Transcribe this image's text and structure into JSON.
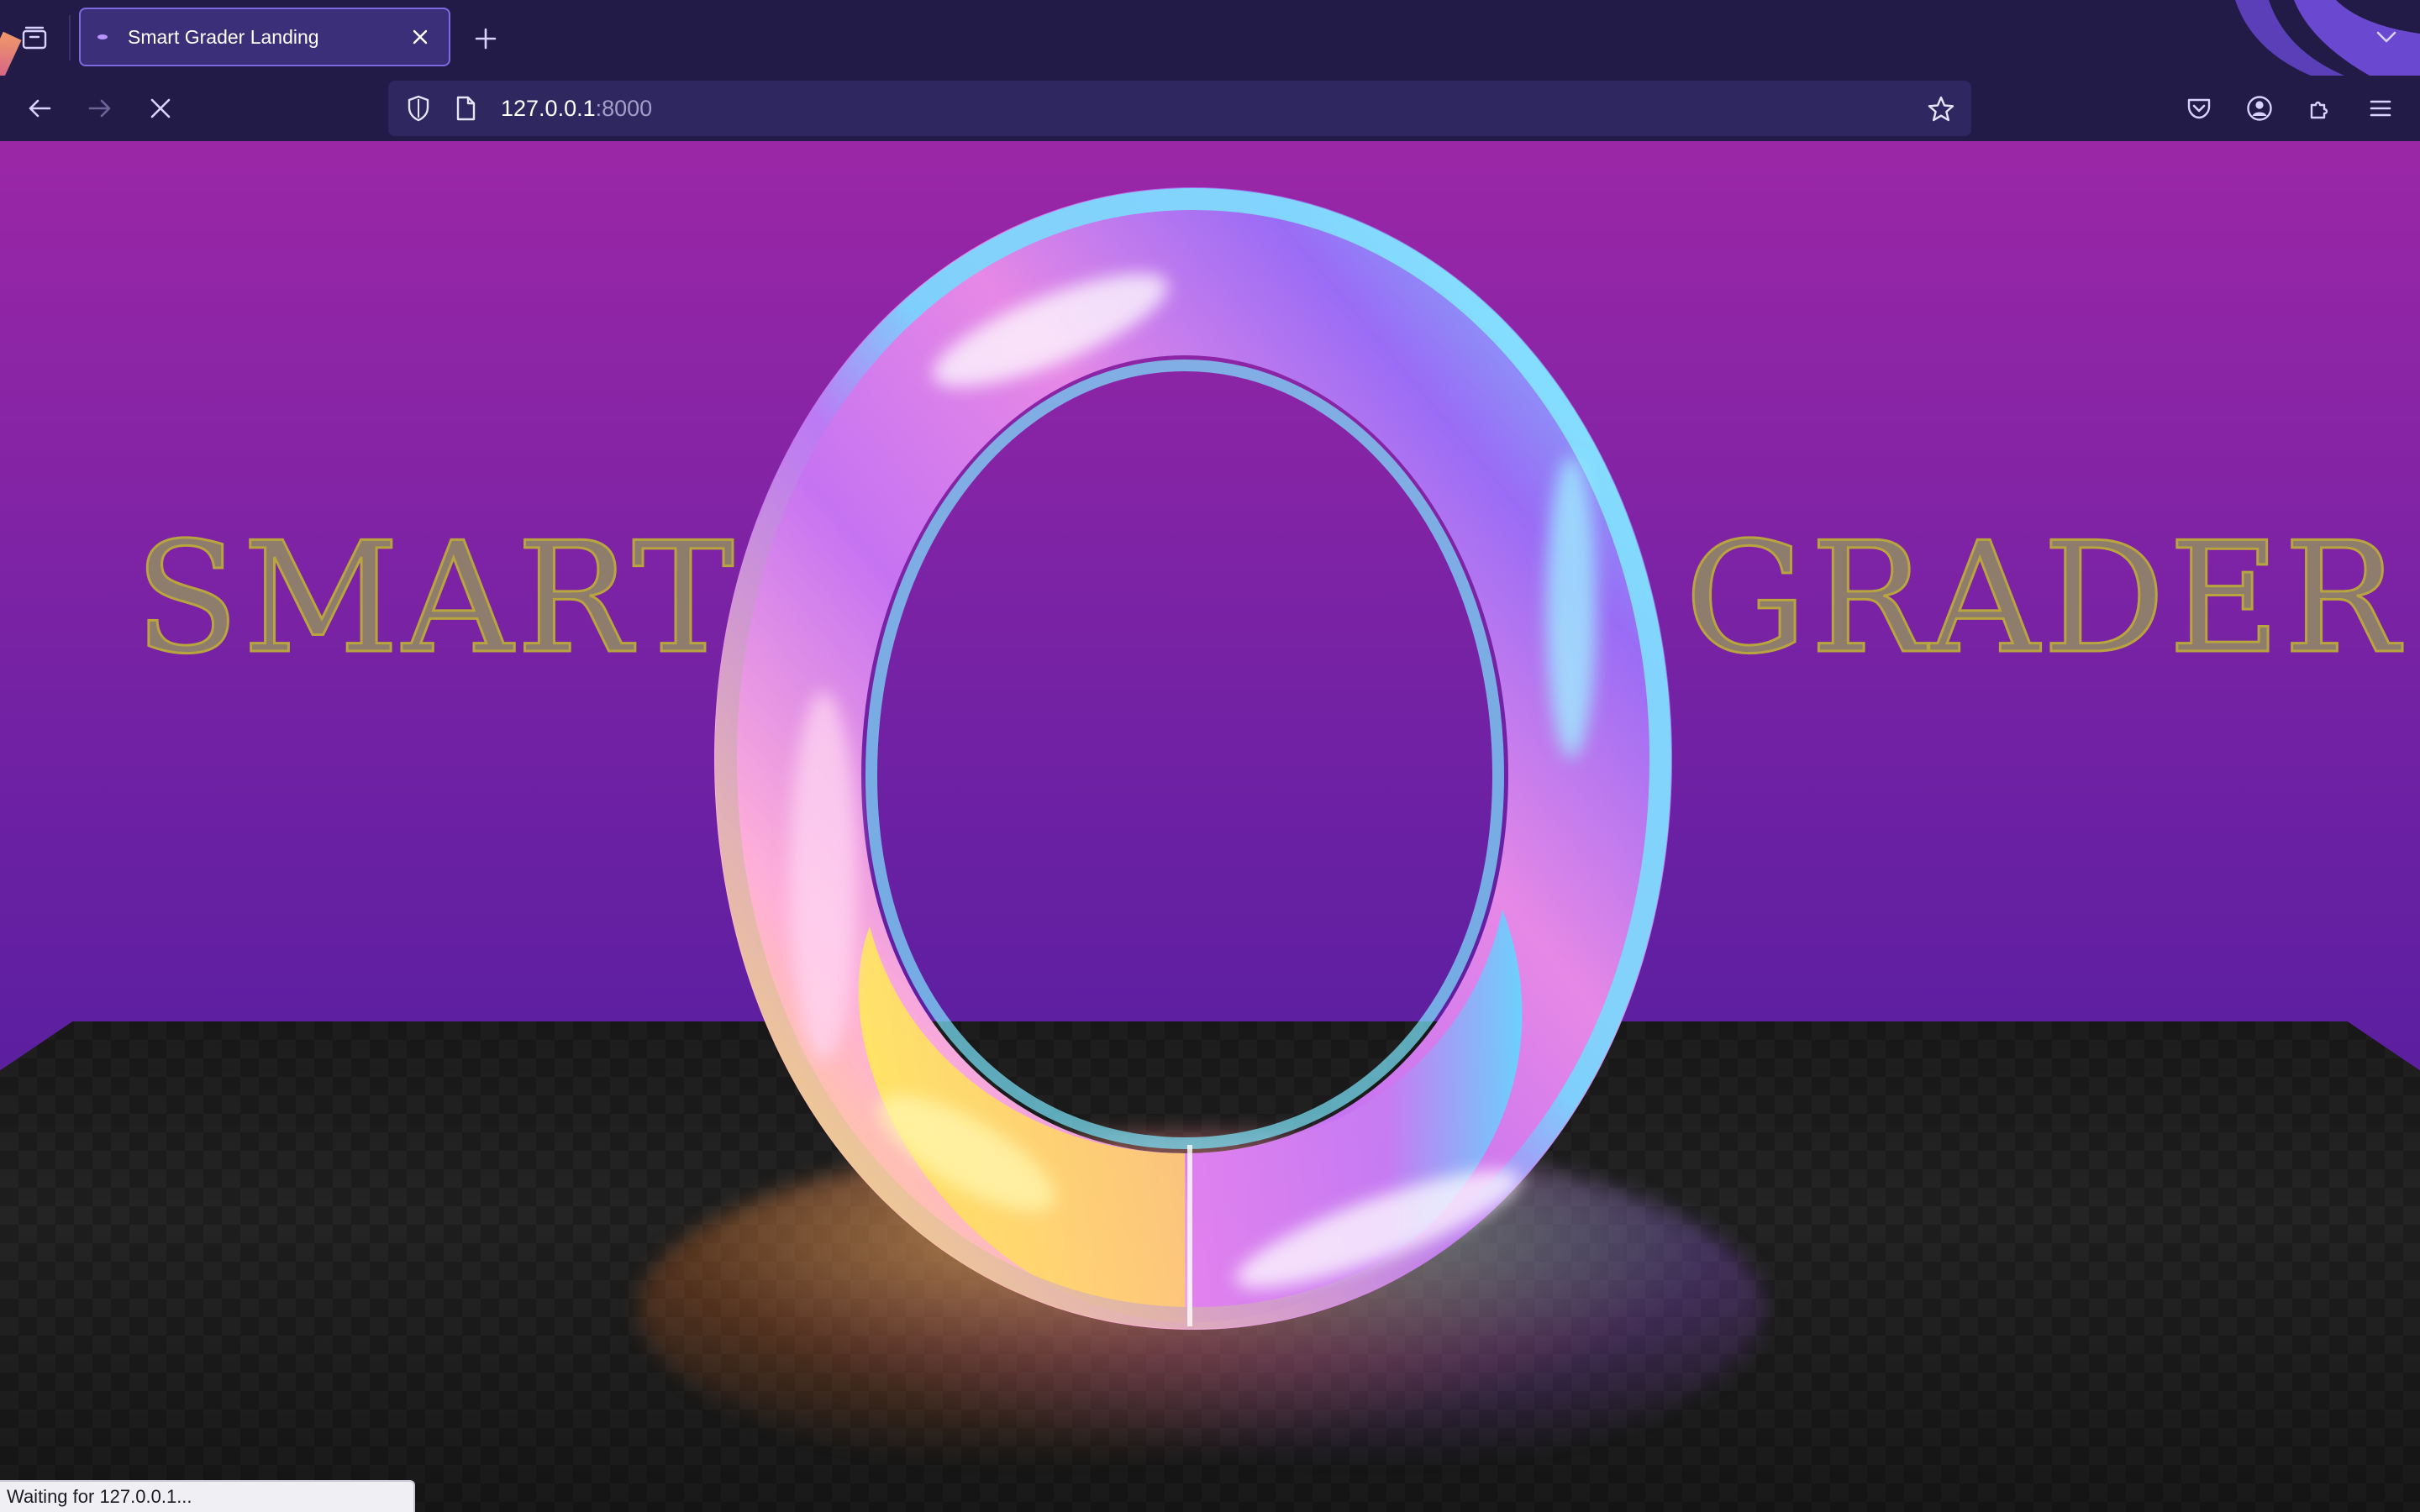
{
  "tab": {
    "title": "Smart Grader Landing"
  },
  "navigation": {
    "url_host": "127.0.0.1",
    "url_port": ":8000"
  },
  "page": {
    "word_left": "SMART",
    "word_right": "GRADER"
  },
  "status": {
    "text": "Waiting for 127.0.0.1..."
  },
  "icons": {
    "tab_overview": "tab-overview-icon",
    "favicon": "favicon-icon",
    "close_tab": "close-icon",
    "new_tab": "plus-icon",
    "list_tabs": "chevron-down-icon",
    "back": "back-arrow-icon",
    "forward": "forward-arrow-icon",
    "stop": "stop-icon",
    "shield": "shield-icon",
    "page": "page-icon",
    "bookmark": "star-icon",
    "pocket": "pocket-icon",
    "account": "account-icon",
    "extensions": "puzzle-icon",
    "menu": "hamburger-menu-icon"
  },
  "colors": {
    "chrome_bg": "#221b47",
    "tab_active": "#3c2f7a",
    "tab_border": "#7d6ae0",
    "urlbar_bg": "#2e2760",
    "sky_top": "#9b27a6",
    "sky_bottom": "#5a1f9f",
    "text_fill": "#8e7c6c",
    "text_stroke": "#b8a53e"
  }
}
